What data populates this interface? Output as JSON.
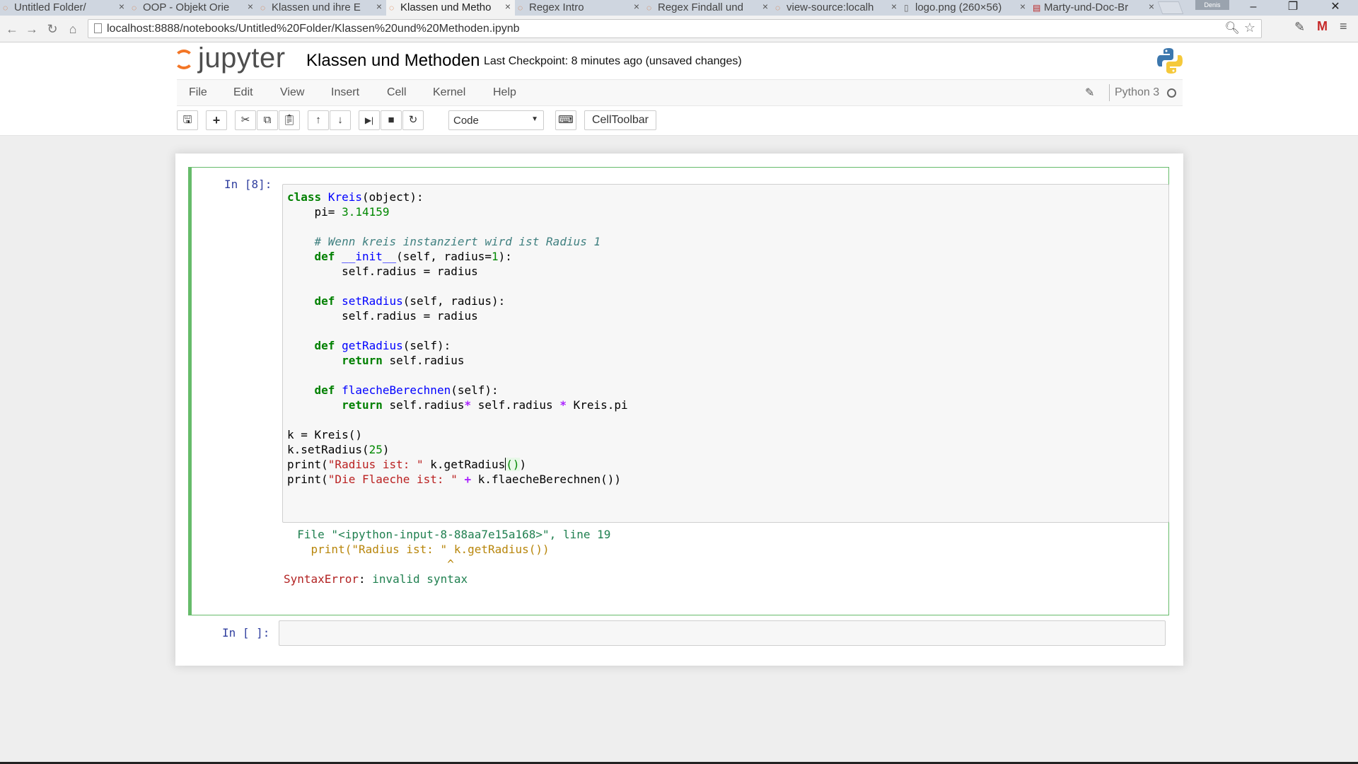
{
  "browser": {
    "tabs": [
      {
        "label": "Untitled Folder/",
        "active": false
      },
      {
        "label": "OOP - Objekt Orie",
        "active": false
      },
      {
        "label": "Klassen und ihre E",
        "active": false
      },
      {
        "label": "Klassen und Metho",
        "active": true
      },
      {
        "label": "Regex Intro",
        "active": false
      },
      {
        "label": "Regex Findall und",
        "active": false
      },
      {
        "label": "view-source:localh",
        "active": false
      },
      {
        "label": "logo.png (260×56)",
        "active": false
      },
      {
        "label": "Marty-und-Doc-Br",
        "active": false
      }
    ],
    "profile": "Denis",
    "url": "localhost:8888/notebooks/Untitled%20Folder/Klassen%20und%20Methoden.ipynb"
  },
  "header": {
    "logo_text": "jupyter",
    "notebook_name": "Klassen und Methoden",
    "checkpoint": "Last Checkpoint: 8 minutes ago (unsaved changes)"
  },
  "menu": {
    "items": [
      "File",
      "Edit",
      "View",
      "Insert",
      "Cell",
      "Kernel",
      "Help"
    ],
    "kernel_name": "Python 3"
  },
  "toolbar": {
    "cell_type": "Code",
    "celltoolbar_label": "CellToolbar"
  },
  "cells": [
    {
      "prompt": "In [8]:",
      "code": [
        "class Kreis(object):",
        "    pi= 3.14159",
        "",
        "    # Wenn kreis instanziert wird ist Radius 1",
        "    def __init__(self, radius=1):",
        "        self.radius = radius",
        "",
        "    def setRadius(self, radius):",
        "        self.radius = radius",
        "",
        "    def getRadius(self):",
        "        return self.radius",
        "",
        "    def flaecheBerechnen(self):",
        "        return self.radius* self.radius * Kreis.pi",
        "",
        "k = Kreis()",
        "k.setRadius(25)",
        "print(\"Radius ist: \" k.getRadius())",
        "print(\"Die Flaeche ist: \" + k.flaecheBerechnen())"
      ],
      "output": {
        "file_line": "  File \"<ipython-input-8-88aa7e15a168>\", line 19",
        "code_line": "    print(\"Radius ist: \" k.getRadius())",
        "caret": "                        ^",
        "error_name": "SyntaxError",
        "error_msg": "invalid syntax"
      }
    },
    {
      "prompt": "In [ ]:"
    }
  ]
}
